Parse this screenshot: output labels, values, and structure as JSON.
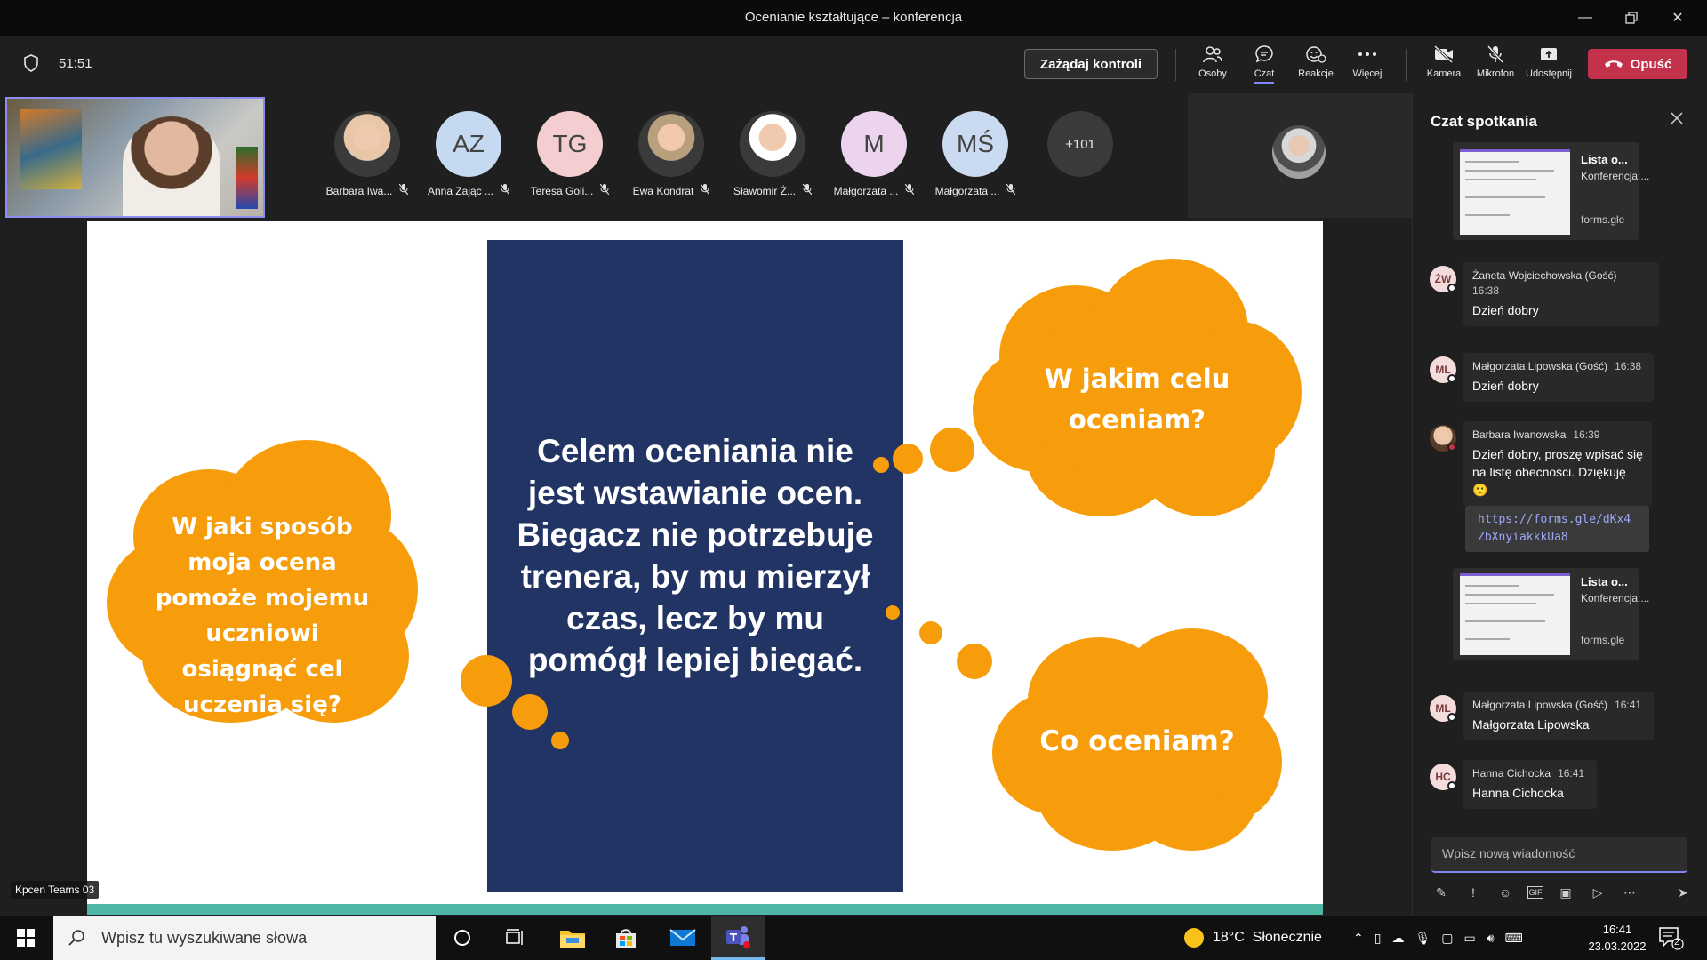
{
  "window": {
    "title": "Ocenianie kształtujące – konferencja"
  },
  "toolbar": {
    "timer": "51:51",
    "take_control": "Zażądaj kontroli",
    "tools": [
      {
        "label": "Osoby",
        "icon": "people-icon"
      },
      {
        "label": "Czat",
        "icon": "chat-icon"
      },
      {
        "label": "Reakcje",
        "icon": "reactions-icon"
      },
      {
        "label": "Więcej",
        "icon": "more-icon"
      },
      {
        "label": "Kamera",
        "icon": "camera-off-icon"
      },
      {
        "label": "Mikrofon",
        "icon": "mic-off-icon"
      },
      {
        "label": "Udostępnij",
        "icon": "share-icon"
      }
    ],
    "leave": "Opuść"
  },
  "participants": [
    {
      "name": "Barbara Iwa...",
      "initials": "",
      "bg": "#e8c7a8"
    },
    {
      "name": "Anna Zając ...",
      "initials": "AZ",
      "bg": "#c5d9f0"
    },
    {
      "name": "Teresa Goli...",
      "initials": "TG",
      "bg": "#f4cdd1"
    },
    {
      "name": "Ewa Kondrat",
      "initials": "",
      "bg": "#b9a07c"
    },
    {
      "name": "Sławomir Ż...",
      "initials": "",
      "bg": "#ffffff"
    },
    {
      "name": "Małgorzata ...",
      "initials": "M",
      "bg": "#ecd3ee"
    },
    {
      "name": "Małgorzata ...",
      "initials": "MŚ",
      "bg": "#c9daf1"
    }
  ],
  "more_participants": "+101",
  "slide": {
    "center_text": "Celem oceniania nie jest wstawianie ocen. Biegacz nie potrzebuje trenera, by mu mierzył czas, lecz by mu pomógł lepiej biegać.",
    "cloud_left": "W jaki sposób moja ocena pomoże mojemu uczniowi osiągnąć cel uczenia się?",
    "cloud_top_right": "W jakim celu oceniam?",
    "cloud_bottom_right": "Co oceniam?"
  },
  "room_label": "Kpcen Teams 03",
  "chat": {
    "title": "Czat spotkania",
    "card": {
      "title": "Lista o...",
      "subtitle": "Konferencja:...",
      "domain": "forms.gle"
    },
    "messages": [
      {
        "initials": "ŻW",
        "author": "Żaneta Wojciechowska (Gość)",
        "time": "16:38",
        "text": "Dzień dobry"
      },
      {
        "initials": "ML",
        "author": "Małgorzata Lipowska (Gość)",
        "time": "16:38",
        "text": "Dzień dobry"
      },
      {
        "initials": "",
        "author": "Barbara Iwanowska",
        "time": "16:39",
        "text": "Dzień dobry, proszę wpisać się na listę obecności. Dziękuję 🙂"
      },
      {
        "initials": "ML",
        "author": "Małgorzata Lipowska (Gość)",
        "time": "16:41",
        "text": "Małgorzata Lipowska"
      },
      {
        "initials": "HC",
        "author": "Hanna Cichocka",
        "time": "16:41",
        "text": "Hanna Cichocka"
      }
    ],
    "link": "https://forms.gle/dKx4ZbXnyiakkkUa8",
    "compose_placeholder": "Wpisz nową wiadomość"
  },
  "taskbar": {
    "search_placeholder": "Wpisz tu wyszukiwane słowa",
    "weather": "18°C  Słonecznie",
    "time": "16:41",
    "date": "23.03.2022",
    "notifications": "2"
  },
  "colors": {
    "accent": "#7f85f5",
    "leave": "#c4314b",
    "cloud": "#f79d0c",
    "panel": "#223464",
    "teal": "#4fb6a6"
  }
}
